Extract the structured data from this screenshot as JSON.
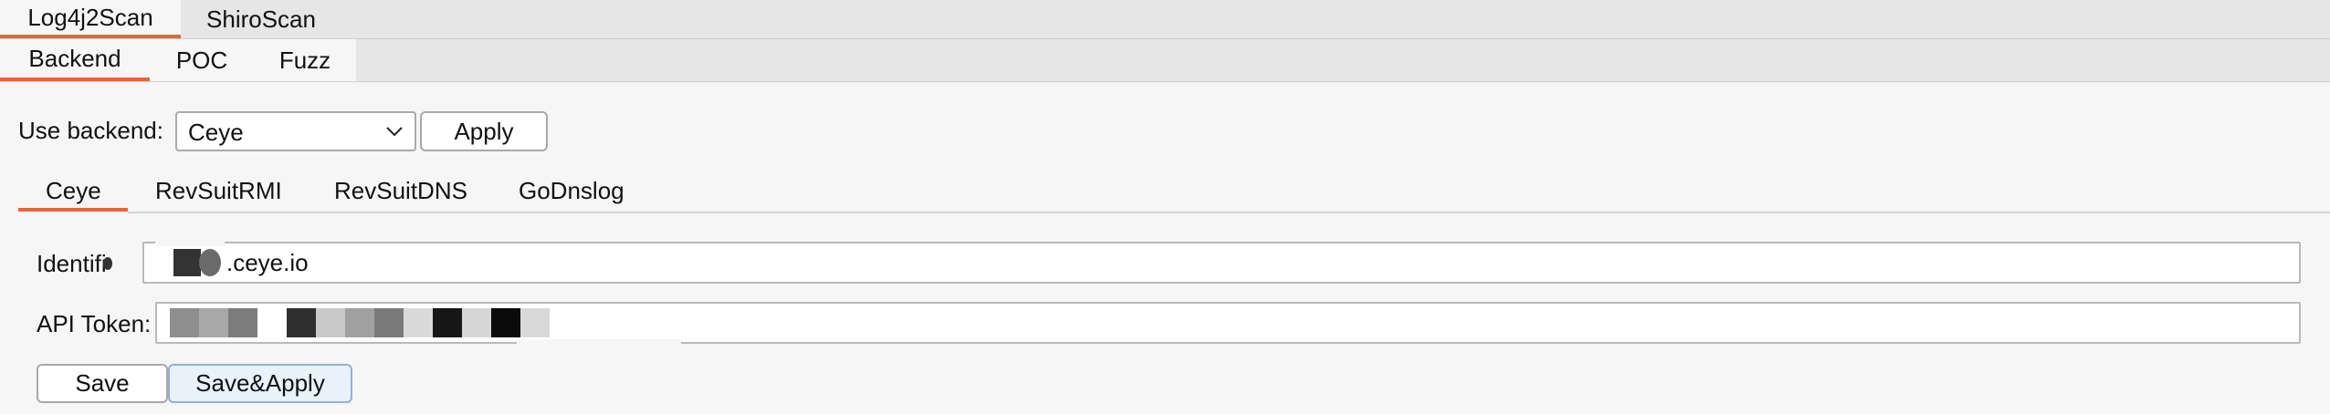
{
  "top_tabs": [
    {
      "label": "Log4j2Scan",
      "active": true
    },
    {
      "label": "ShiroScan",
      "active": false
    }
  ],
  "sub_tabs": [
    {
      "label": "Backend",
      "active": true
    },
    {
      "label": "POC",
      "active": false
    },
    {
      "label": "Fuzz",
      "active": false
    }
  ],
  "backend": {
    "label": "Use backend:",
    "selected": "Ceye",
    "apply_label": "Apply"
  },
  "backend_tabs": [
    {
      "label": "Ceye",
      "active": true
    },
    {
      "label": "RevSuitRMI",
      "active": false
    },
    {
      "label": "RevSuitDNS",
      "active": false
    },
    {
      "label": "GoDnslog",
      "active": false
    }
  ],
  "ceye": {
    "identifier_label": "Identifi",
    "identifier_value": ".ceye.io",
    "token_label": "API Token:",
    "save_label": "Save",
    "save_apply_label": "Save&Apply"
  },
  "colors": {
    "accent": "#e8643a",
    "tab_bar": "#e6e6e6",
    "background": "#f6f6f6"
  }
}
